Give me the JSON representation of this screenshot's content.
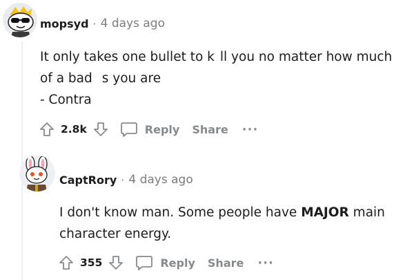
{
  "comments": [
    {
      "username": "mopsyd",
      "separator": "·",
      "time": "4 days ago",
      "line1_a": "It only takes one bullet to k",
      "line1_b": "ll you no matter how much",
      "line2_a": "of a bad",
      "line2_b": "s you are",
      "line3": "- Contra",
      "vote_count": "2.8k",
      "reply_label": "Reply",
      "share_label": "Share",
      "more_label": "···",
      "avatar_icon": "sunglasses-snoo-avatar"
    },
    {
      "username": "CaptRory",
      "separator": "·",
      "time": "4 days ago",
      "line1_a": "I don't know man. Some people have",
      "line1_bold": "MAJOR",
      "line1_b": "main",
      "line2": "character energy.",
      "vote_count": "355",
      "reply_label": "Reply",
      "share_label": "Share",
      "more_label": "···",
      "avatar_icon": "bunny-snoo-avatar"
    }
  ],
  "colors": {
    "text": "#1c1c1c",
    "meta": "#7c7c7c",
    "action": "#878a8c",
    "thread_line": "#edeff1"
  }
}
